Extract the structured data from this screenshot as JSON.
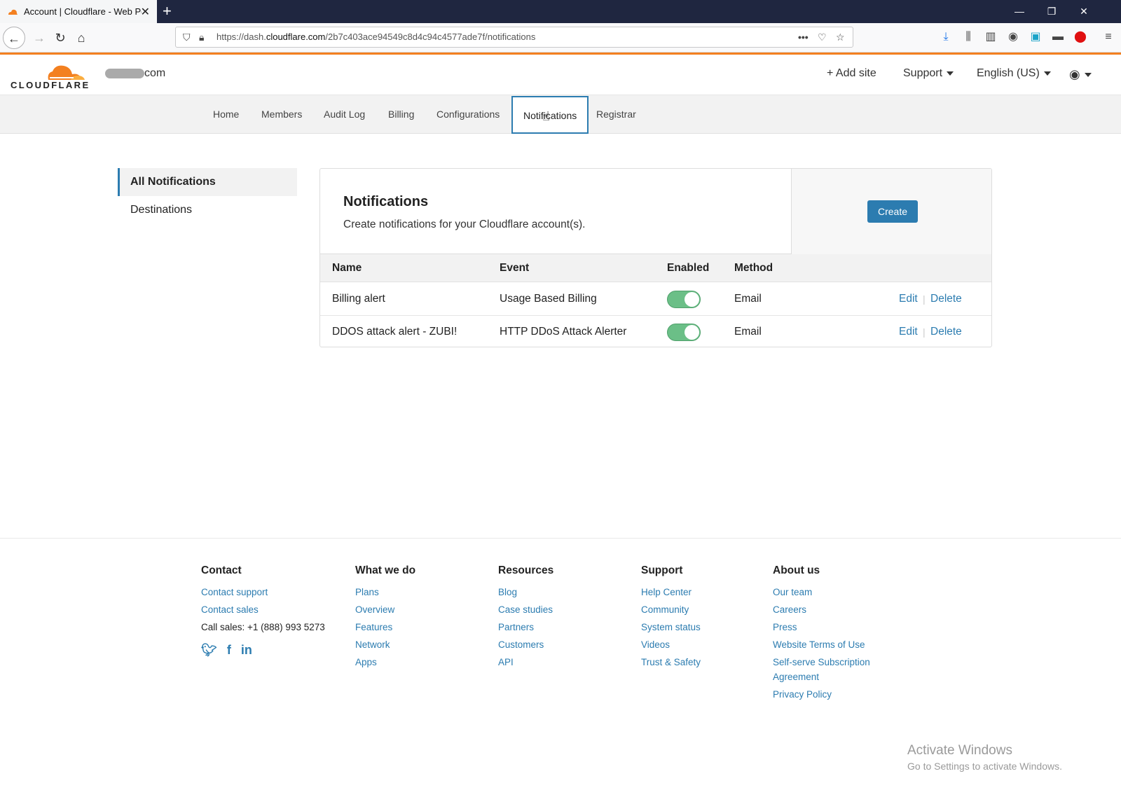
{
  "browser": {
    "tab_title": "Account | Cloudflare - Web Pe",
    "url_prefix": "https://dash.",
    "url_host": "cloudflare.com",
    "url_path": "/2b7c403ace94549c8d4c94c4577ade7f/notifications"
  },
  "header": {
    "logo_text": "CLOUDFLARE",
    "domain_suffix": "com",
    "add_site": "Add site",
    "support": "Support",
    "language": "English (US)"
  },
  "account_tabs": [
    {
      "label": "Home"
    },
    {
      "label": "Members"
    },
    {
      "label": "Audit Log"
    },
    {
      "label": "Billing"
    },
    {
      "label": "Configurations"
    },
    {
      "label": "Notifications"
    },
    {
      "label": "Registrar"
    }
  ],
  "sidebar": {
    "items": [
      {
        "label": "All Notifications"
      },
      {
        "label": "Destinations"
      }
    ]
  },
  "card": {
    "title": "Notifications",
    "description": "Create notifications for your Cloudflare account(s).",
    "create_label": "Create",
    "columns": [
      "Name",
      "Event",
      "Enabled",
      "Method"
    ],
    "rows": [
      {
        "name": "Billing alert",
        "event": "Usage Based Billing",
        "enabled": true,
        "method": "Email",
        "edit": "Edit",
        "delete": "Delete"
      },
      {
        "name": "DDOS attack alert - ZUBI!",
        "event": "HTTP DDoS Attack Alerter",
        "enabled": true,
        "method": "Email",
        "edit": "Edit",
        "delete": "Delete"
      }
    ]
  },
  "footer": {
    "contact": {
      "heading": "Contact",
      "links": [
        "Contact support",
        "Contact sales"
      ],
      "phone": "Call sales: +1 (888) 993 5273"
    },
    "what_we_do": {
      "heading": "What we do",
      "links": [
        "Plans",
        "Overview",
        "Features",
        "Network",
        "Apps"
      ]
    },
    "resources": {
      "heading": "Resources",
      "links": [
        "Blog",
        "Case studies",
        "Partners",
        "Customers",
        "API"
      ]
    },
    "support": {
      "heading": "Support",
      "links": [
        "Help Center",
        "Community",
        "System status",
        "Videos",
        "Trust & Safety"
      ]
    },
    "about": {
      "heading": "About us",
      "links": [
        "Our team",
        "Careers",
        "Press",
        "Website Terms of Use",
        "Self-serve Subscription",
        "Agreement",
        "Privacy Policy"
      ]
    }
  },
  "watermark": {
    "line1": "Activate Windows",
    "line2": "Go to Settings to activate Windows."
  },
  "colors": {
    "accent": "#2c7cb0",
    "cloudflare_orange": "#f38020",
    "toggle_on": "#6bbf87"
  }
}
